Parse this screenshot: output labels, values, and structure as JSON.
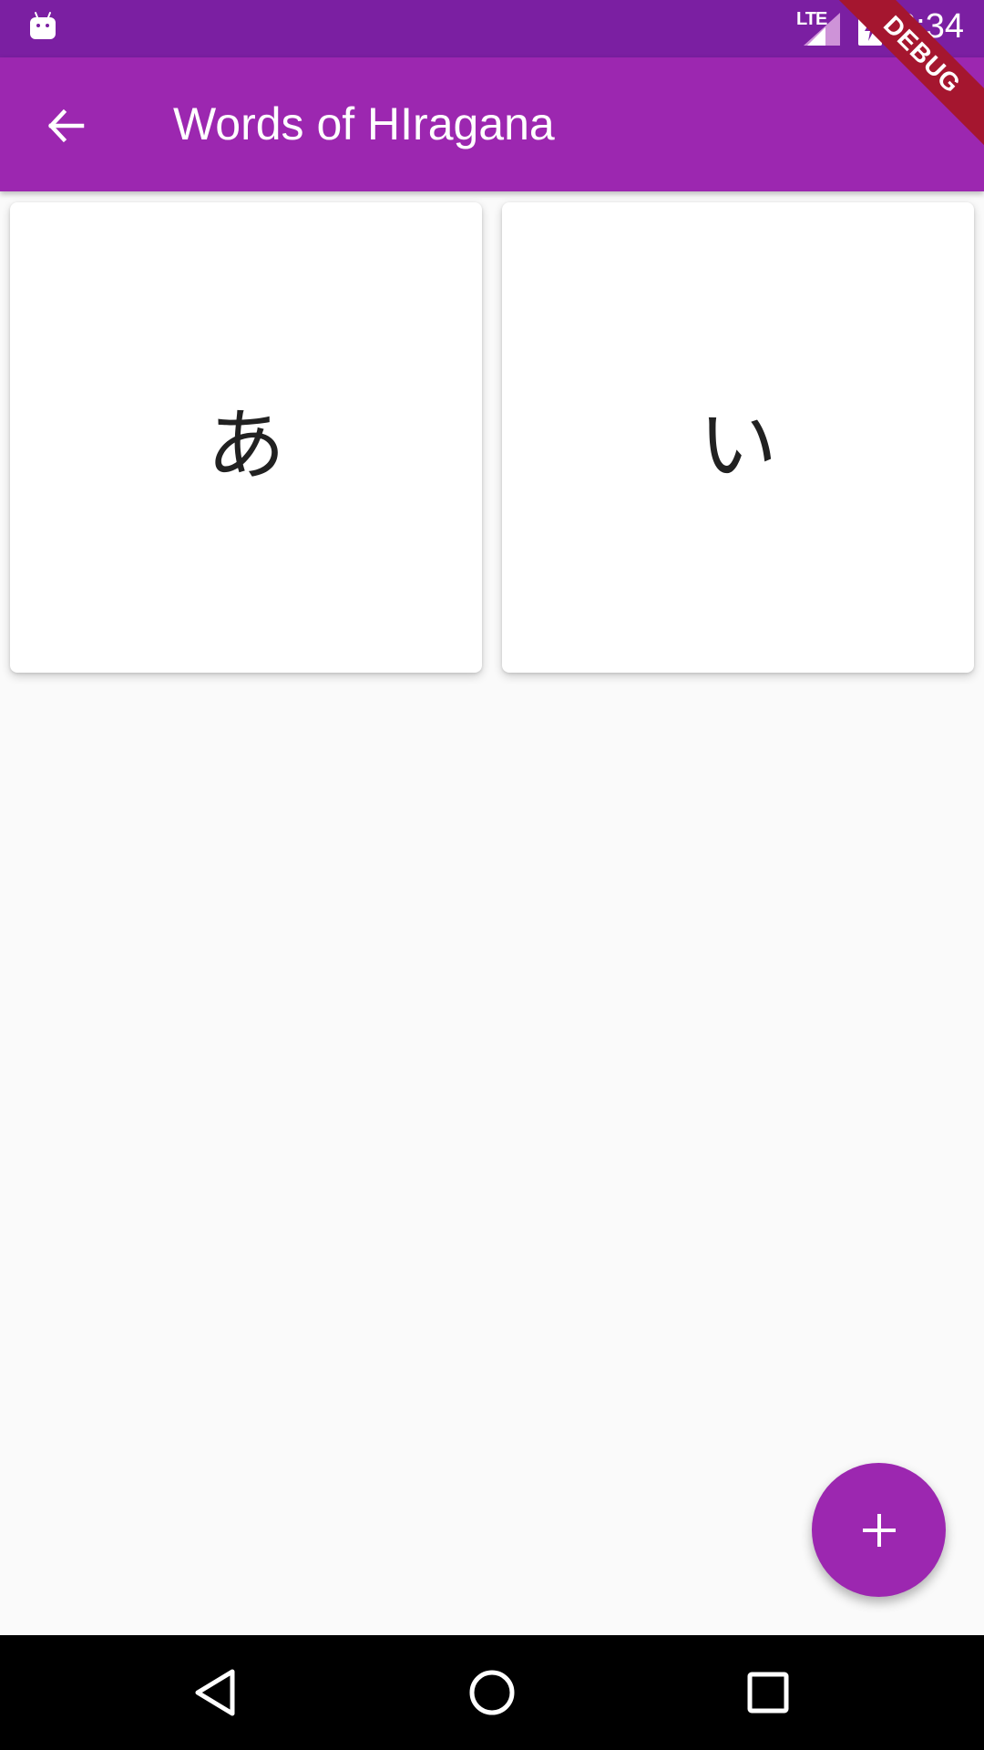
{
  "status_bar": {
    "time": "6:34",
    "network_label": "LTE",
    "icons": [
      "android-icon",
      "signal-icon",
      "battery-charging-icon"
    ],
    "background_color": "#7b1fa2"
  },
  "app_bar": {
    "title": "Words of HIragana",
    "back_icon": "arrow-back-icon",
    "background_color": "#9c27b0"
  },
  "debug_banner": {
    "label": "DEBUG",
    "color": "#a5162f"
  },
  "cards": [
    {
      "character": "あ"
    },
    {
      "character": "い"
    }
  ],
  "fab": {
    "icon": "plus-icon",
    "background_color": "#9c27b0"
  },
  "nav_bar": {
    "buttons": [
      "nav-back-icon",
      "nav-home-icon",
      "nav-recents-icon"
    ]
  }
}
